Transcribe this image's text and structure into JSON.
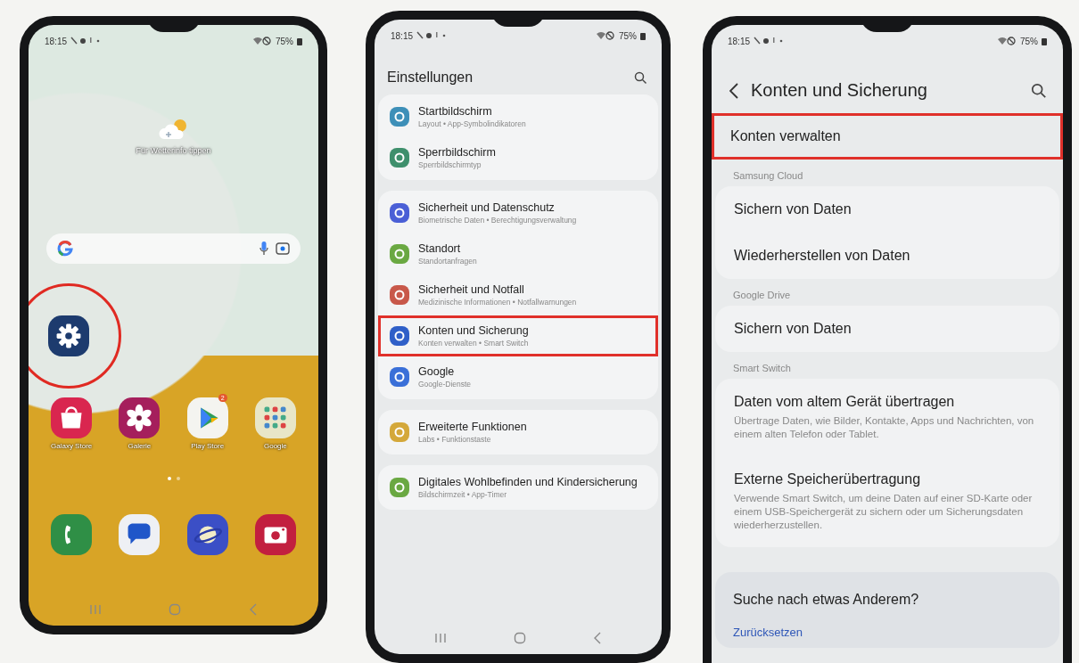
{
  "phones": [
    {
      "kind": "home",
      "status_bar": {
        "time": "18:15",
        "battery": "75%"
      },
      "weather_widget": {
        "label": "Für Wetterinfo tippen"
      },
      "settings_app": {
        "highlighted": true
      },
      "apps": [
        {
          "label": "Galaxy Store"
        },
        {
          "label": "Galerie"
        },
        {
          "label": "Play Store",
          "badge": "2"
        },
        {
          "label": "Google"
        }
      ],
      "page_dots": [
        {
          "selected": true
        },
        {
          "selected": false
        }
      ]
    },
    {
      "kind": "settings",
      "status_bar": {
        "time": "18:15",
        "battery": "75%"
      },
      "title": "Einstellungen",
      "groups": [
        {
          "items": [
            {
              "title": "Startbildschirm",
              "subtitle": "Layout • App-Symbolindikatoren",
              "color": "#3d8fb8",
              "highlighted": false
            },
            {
              "title": "Sperrbildschirm",
              "subtitle": "Sperrbildschirmtyp",
              "color": "#3e8f6c",
              "highlighted": false
            }
          ]
        },
        {
          "items": [
            {
              "title": "Sicherheit und Datenschutz",
              "subtitle": "Biometrische Daten • Berechtigungsverwaltung",
              "color": "#4a5fd6",
              "highlighted": false
            },
            {
              "title": "Standort",
              "subtitle": "Standortanfragen",
              "color": "#6aa842",
              "highlighted": false
            },
            {
              "title": "Sicherheit und Notfall",
              "subtitle": "Medizinische Informationen • Notfallwarnungen",
              "color": "#c8584a",
              "highlighted": false
            },
            {
              "title": "Konten und Sicherung",
              "subtitle": "Konten verwalten • Smart Switch",
              "color": "#2f5fc8",
              "highlighted": true
            },
            {
              "title": "Google",
              "subtitle": "Google-Dienste",
              "color": "#3a6fd8",
              "highlighted": false
            }
          ]
        },
        {
          "items": [
            {
              "title": "Erweiterte Funktionen",
              "subtitle": "Labs • Funktionstaste",
              "color": "#d4a83a",
              "highlighted": false
            }
          ]
        },
        {
          "items": [
            {
              "title": "Digitales Wohlbefinden und Kindersicherung",
              "subtitle": "Bildschirmzeit • App-Timer",
              "color": "#6aa842",
              "highlighted": false
            }
          ]
        }
      ]
    },
    {
      "kind": "detail",
      "status_bar": {
        "time": "18:15",
        "battery": "75%"
      },
      "title": "Konten und Sicherung",
      "sections": [
        {
          "items": [
            {
              "title": "Konten verwalten",
              "highlighted": true
            }
          ]
        },
        {
          "header": "Samsung Cloud",
          "items": [
            {
              "title": "Sichern von Daten",
              "highlighted": false
            },
            {
              "title": "Wiederherstellen von Daten",
              "highlighted": false
            }
          ]
        },
        {
          "header": "Google Drive",
          "items": [
            {
              "title": "Sichern von Daten",
              "highlighted": false
            }
          ]
        },
        {
          "header": "Smart Switch",
          "items": [
            {
              "title": "Daten vom altem Gerät übertragen",
              "subtitle": "Übertrage Daten, wie Bilder, Kontakte, Apps und Nachrichten, von einem alten Telefon oder Tablet.",
              "highlighted": false
            },
            {
              "title": "Externe Speicherübertragung",
              "subtitle": "Verwende Smart Switch, um deine Daten auf einer SD-Karte oder einem USB-Speichergerät zu sichern oder um Sicherungsdaten wiederherzustellen.",
              "highlighted": false
            }
          ]
        }
      ],
      "suggestion": {
        "title": "Suche nach etwas Anderem?",
        "link": "Zurücksetzen"
      }
    }
  ]
}
